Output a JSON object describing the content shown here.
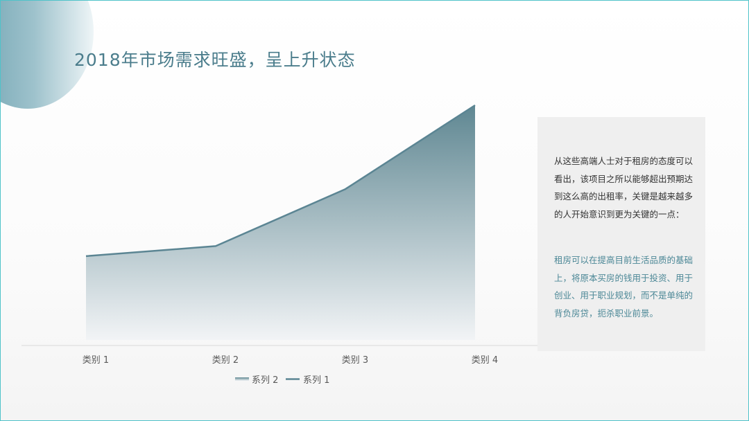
{
  "title": "2018年市场需求旺盛，呈上升状态",
  "colors": {
    "accent": "#5b8593",
    "area_top": "#5f8792",
    "area_bottom": "#f2f4f6",
    "title": "#4b7d8c",
    "highlight_text": "#4b8796"
  },
  "side_panel": {
    "paragraph1": "从这些高端人士对于租房的态度可以看出，该项目之所以能够超出预期达到这么高的出租率，关键是越来越多的人开始意识到更为关键的一点：",
    "paragraph2": "租房可以在提高目前生活品质的基础上，将原本买房的钱用于投资、用于创业、用于职业规划，而不是单纯的背负房贷，扼杀职业前景。"
  },
  "chart_data": {
    "type": "area",
    "categories": [
      "类别 1",
      "类别 2",
      "类别 3",
      "类别 4"
    ],
    "series": [
      {
        "name": "系列 2",
        "type": "area",
        "values": [
          2.5,
          2.8,
          4.5,
          7.0
        ]
      },
      {
        "name": "系列 1",
        "type": "line",
        "values": [
          2.5,
          2.8,
          4.5,
          7.0
        ]
      }
    ],
    "ylim": [
      0,
      7.0
    ],
    "grid": false,
    "legend_position": "bottom"
  }
}
